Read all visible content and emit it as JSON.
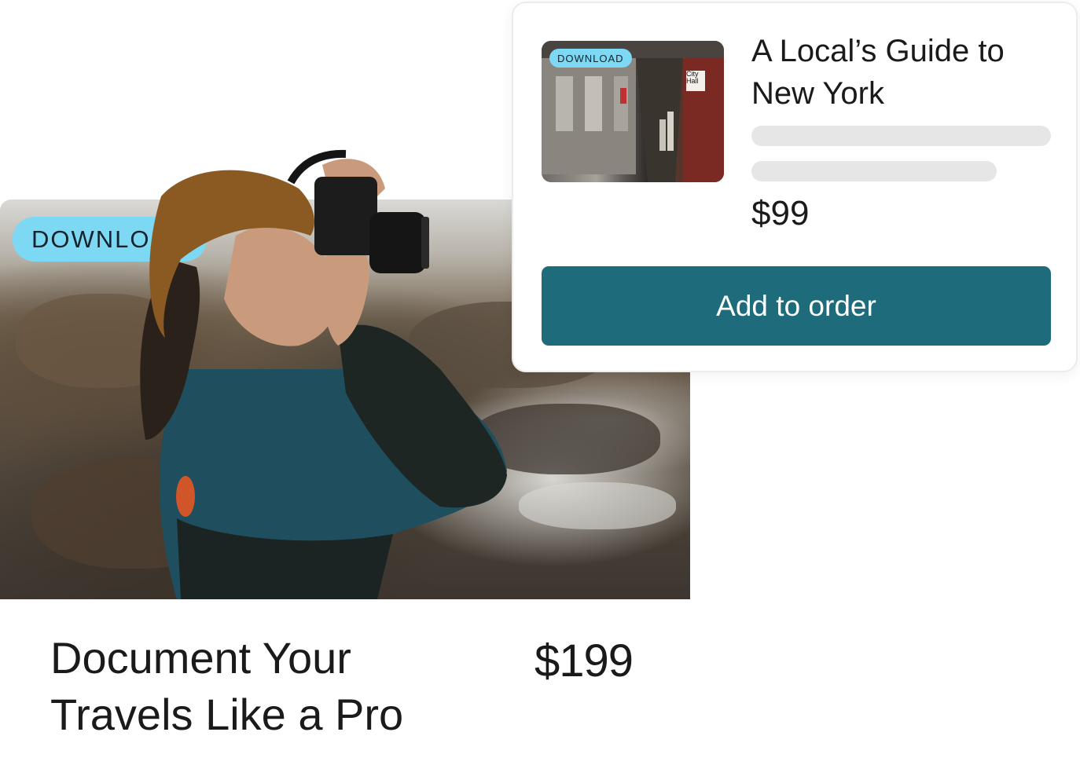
{
  "main_product": {
    "badge": "DOWNLOAD",
    "title": "Document Your Travels Like a Pro",
    "price": "$199"
  },
  "popup_product": {
    "badge": "DOWNLOAD",
    "title": "A Local’s Guide to New York",
    "price": "$99",
    "thumbnail_sign": "City Hall",
    "cta_label": "Add to order"
  },
  "colors": {
    "badge": "#7dd8f4",
    "cta": "#1d6b7b",
    "skeleton": "#e6e6e6"
  }
}
